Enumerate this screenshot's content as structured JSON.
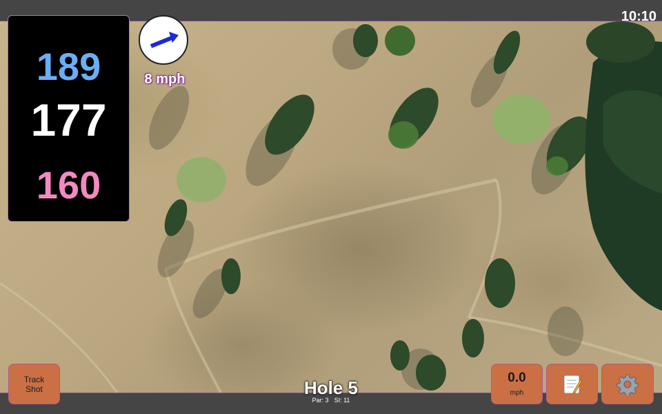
{
  "status_bar": {
    "time": "10:10"
  },
  "distances": {
    "back": "189",
    "middle": "177",
    "front": "160"
  },
  "wind": {
    "direction_icon": "wind-arrow-icon",
    "speed": "8 mph"
  },
  "buttons": {
    "track_shot": "Track Shot",
    "wind_value": "0.0",
    "wind_unit": "mph",
    "notes_icon": "memo-icon",
    "settings_icon": "gear-icon"
  },
  "hole": {
    "title": "Hole 5",
    "par": "Par: 3",
    "si": "SI: 11"
  },
  "colors": {
    "back": "#6aaef5",
    "middle": "#ffffff",
    "front": "#f28ac2",
    "button": "#cb6f45"
  }
}
